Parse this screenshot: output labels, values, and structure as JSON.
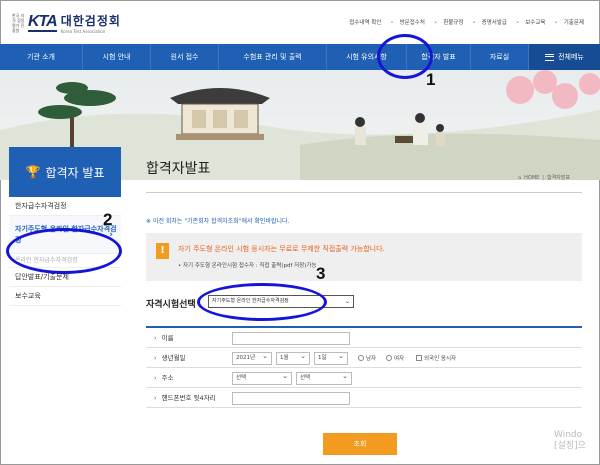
{
  "header": {
    "logo_small": "한국 자격 검정 평가 진흥원",
    "logo_abbr": "KTA",
    "logo_name": "대한검정회",
    "logo_en": "Korea Test Association",
    "util_links": [
      "접수내역 확인",
      "방문접수처",
      "환불규정",
      "증명서발급",
      "보수교육",
      "기출문제"
    ]
  },
  "nav": {
    "items": [
      "기관 소개",
      "시험 안내",
      "원서 접수",
      "수험표 관리 및 출력",
      "시험 유의사항",
      "합격자 발표",
      "자료실"
    ],
    "all_menu": "전체메뉴"
  },
  "sidebar": {
    "title": "합격자 발표",
    "items": [
      "한자급수자격검정",
      "자기주도형 온라인 한자급수자격검정",
      "온라인 한자급수자격검정",
      "답안발표/기출문제",
      "보수교육"
    ],
    "chevron": "›"
  },
  "content": {
    "page_title": "합격자발표",
    "breadcrumb": [
      "HOME",
      "합격자발표"
    ],
    "note": "※ 이전 회차는 \"기존회차 합격자조회\"에서 확인바랍니다.",
    "notice_mark": "!",
    "notice_title": "자기 주도형 온라인 시험 응시자는 무료로 무제한 직접출력 가능합니다.",
    "notice_sub": "• 자기 주도형 온라인시험 접수자 : 직접 출력(pdf 저장)가능",
    "qualification_label": "자격시험선택",
    "qualification_value": "자기주도형 온라인 한자급수자격검정"
  },
  "form": {
    "name_label": "이름",
    "birth_label": "생년월일",
    "birth_year": "2021년",
    "birth_month": "1월",
    "birth_day": "1일",
    "gender_male": "남자",
    "gender_female": "여자",
    "foreign_label": "외국인 응시자",
    "address_label": "주소",
    "address_select1": "선택",
    "address_select2": "선택",
    "phone_label": "핸드폰번호 뒷4자리",
    "submit": "조회"
  },
  "watermark": {
    "line1": "Windo",
    "line2": "[설정]으"
  },
  "annotations": [
    "1",
    "2",
    "3"
  ],
  "colors": {
    "nav_blue": "#1f5fb4",
    "orange": "#f39a21",
    "annotation": "#1515d8"
  }
}
